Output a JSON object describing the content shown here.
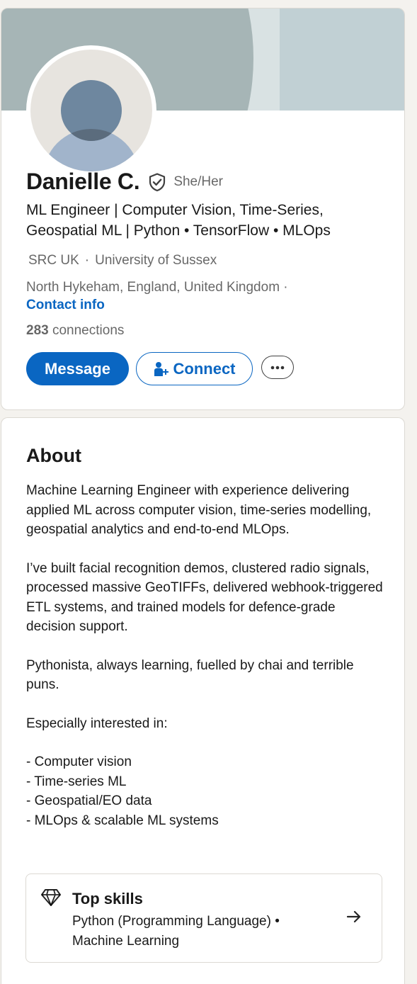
{
  "profile": {
    "name": "Danielle C.",
    "pronouns": "She/Her",
    "headline": "ML Engineer | Computer Vision, Time-Series, Geospatial ML | Python • TensorFlow • MLOps",
    "company": "SRC UK",
    "separator": "·",
    "school": "University of Sussex",
    "location": "North Hykeham, England, United Kingdom ·",
    "contact_info": "Contact info",
    "connections_count": "283",
    "connections_label": "connections",
    "verified_icon": "verified-shield-icon",
    "actions": {
      "message": "Message",
      "connect": "Connect",
      "more_icon": "ellipsis-icon"
    },
    "colors": {
      "accent": "#0a66c2",
      "banner": "#c1d0d4"
    }
  },
  "about": {
    "title": "About",
    "paragraphs": [
      "Machine Learning Engineer with experience delivering applied ML across computer vision, time-series modelling, geospatial analytics and end-to-end MLOps.",
      "I’ve built facial recognition demos, clustered radio signals, processed massive GeoTIFFs, delivered webhook-triggered ETL systems, and trained models for defence-grade decision support.",
      "Pythonista, always learning, fuelled by chai and terrible puns.",
      "Especially interested in:"
    ],
    "interests": [
      "- Computer vision",
      "- Time-series ML",
      "- Geospatial/EO data",
      "- MLOps & scalable ML systems"
    ],
    "top_skills": {
      "title": "Top skills",
      "skills": "Python (Programming Language) • Machine Learning",
      "icon": "diamond-icon",
      "arrow_icon": "arrow-right-icon"
    }
  }
}
